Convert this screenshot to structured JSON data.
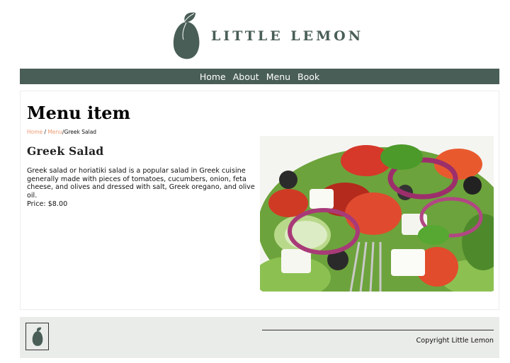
{
  "brand": {
    "name": "LITTLE LEMON",
    "colors": {
      "primary": "#495e57",
      "accent": "#ee9972",
      "footer_bg": "#eaece9"
    },
    "logo_icon": "lemon-icon"
  },
  "nav": {
    "items": [
      {
        "label": "Home"
      },
      {
        "label": "About"
      },
      {
        "label": "Menu"
      },
      {
        "label": "Book"
      }
    ]
  },
  "page": {
    "title": "Menu item",
    "breadcrumb": {
      "home": "Home",
      "sep1": " / ",
      "menu": "Menu",
      "sep2": "/",
      "current": "Greek Salad"
    }
  },
  "item": {
    "name": "Greek Salad",
    "description": "Greek salad or horiatiki salad is a popular salad in Greek cuisine generally made with pieces of tomatoes, cucumbers, onion, feta cheese, and olives and dressed with salt, Greek oregano, and olive oil.",
    "price_label": "Price:",
    "price": "$8.00",
    "photo_icon": "greek-salad-photo"
  },
  "footer": {
    "logo_icon": "lemon-icon",
    "copyright": "Copyright Little Lemon"
  }
}
